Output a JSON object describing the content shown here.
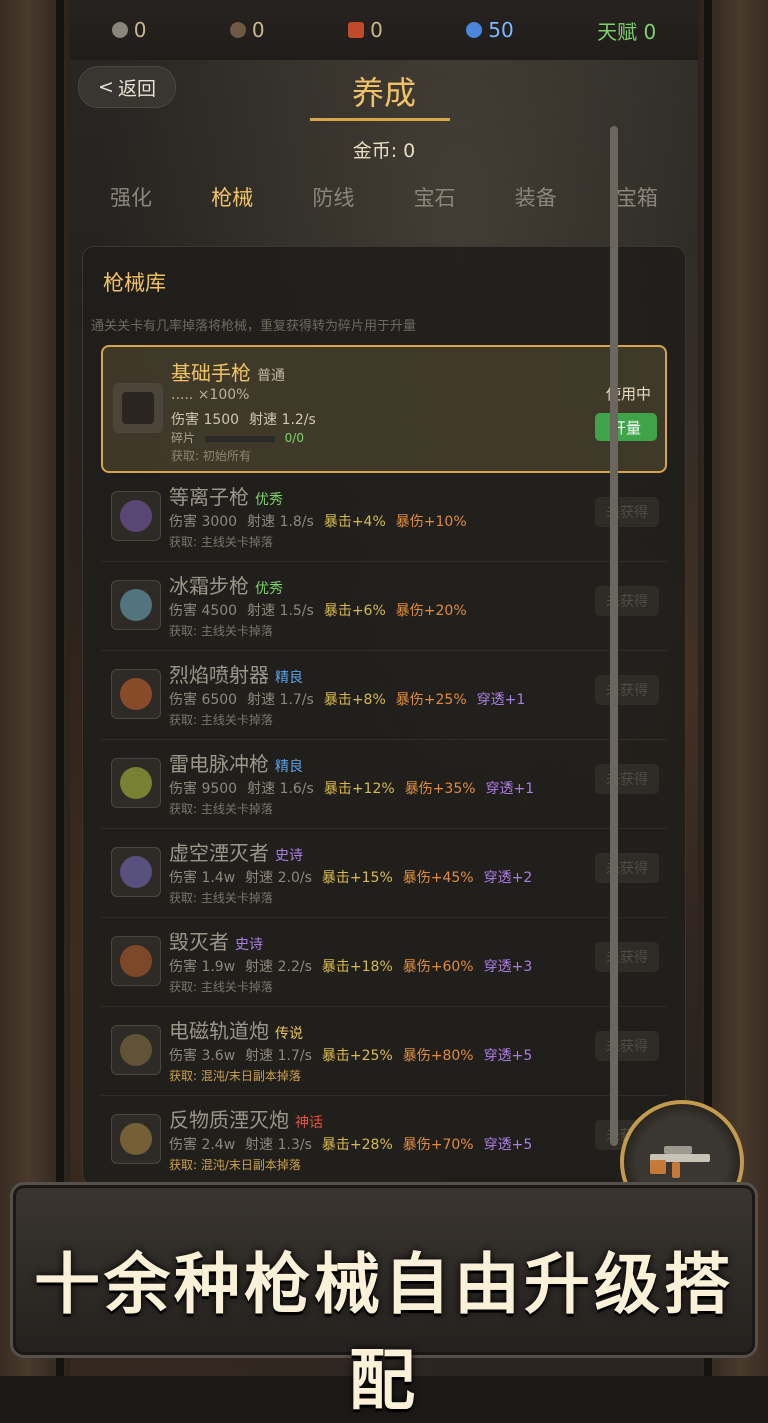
{
  "resources": [
    {
      "icon": "gear-coin-icon",
      "value": "0",
      "color": "#c9b98f"
    },
    {
      "icon": "scrap-icon",
      "value": "0",
      "color": "#c9b98f"
    },
    {
      "icon": "crystal-icon",
      "value": "0",
      "color": "#c9b98f"
    },
    {
      "icon": "gem-icon",
      "value": "50",
      "color": "#7eb6ff"
    }
  ],
  "talent": "天赋 0",
  "back_label": "返回",
  "page_title": "养成",
  "gold": "金币: 0",
  "tabs": [
    "强化",
    "枪械",
    "防线",
    "宝石",
    "装备",
    "宝箱"
  ],
  "active_tab": "枪械",
  "armory": {
    "title": "枪械库",
    "subtitle": "通关关卡有几率掉落将枪械，重复获得转为碎片用于升量",
    "equipped": {
      "name": "基础手枪",
      "rarity": "普通",
      "level": "..... ×100%",
      "dmg": "伤害 1500",
      "rate": "射速 1.2/s",
      "frag_label": "碎片",
      "frag": "0/0",
      "src": "获取: 初始所有",
      "status": "使用中",
      "upgrade": "开量"
    },
    "items": [
      {
        "name": "等离子枪",
        "rarity": "优秀",
        "rcolor": "#7ed36b",
        "dmg": "伤害 3000",
        "rate": "射速 1.8/s",
        "crit": "暴击+4%",
        "cdmg": "暴伤+10%",
        "pierce": "",
        "src": "获取: 主线关卡掉落",
        "btn": "未获得",
        "dot": "#7a5fb0"
      },
      {
        "name": "冰霜步枪",
        "rarity": "优秀",
        "rcolor": "#7ed36b",
        "dmg": "伤害 4500",
        "rate": "射速 1.5/s",
        "crit": "暴击+6%",
        "cdmg": "暴伤+20%",
        "pierce": "",
        "src": "获取: 主线关卡掉落",
        "btn": "未获得",
        "dot": "#6fb0c9"
      },
      {
        "name": "烈焰喷射器",
        "rarity": "精良",
        "rcolor": "#5aa0e8",
        "dmg": "伤害 6500",
        "rate": "射速 1.7/s",
        "crit": "暴击+8%",
        "cdmg": "暴伤+25%",
        "pierce": "穿透+1",
        "src": "获取: 主线关卡掉落",
        "btn": "未获得",
        "dot": "#d1662d"
      },
      {
        "name": "雷电脉冲枪",
        "rarity": "精良",
        "rcolor": "#5aa0e8",
        "dmg": "伤害 9500",
        "rate": "射速 1.6/s",
        "crit": "暴击+12%",
        "cdmg": "暴伤+35%",
        "pierce": "穿透+1",
        "src": "获取: 主线关卡掉落",
        "btn": "未获得",
        "dot": "#b7c63a"
      },
      {
        "name": "虚空湮灭者",
        "rarity": "史诗",
        "rcolor": "#a97ee0",
        "dmg": "伤害 1.4w",
        "rate": "射速 2.0/s",
        "crit": "暴击+15%",
        "cdmg": "暴伤+45%",
        "pierce": "穿透+2",
        "src": "获取: 主线关卡掉落",
        "btn": "未获得",
        "dot": "#7c6fc4"
      },
      {
        "name": "毁灭者",
        "rarity": "史诗",
        "rcolor": "#a97ee0",
        "dmg": "伤害 1.9w",
        "rate": "射速 2.2/s",
        "crit": "暴击+18%",
        "cdmg": "暴伤+60%",
        "pierce": "穿透+3",
        "src": "获取: 主线关卡掉落",
        "btn": "未获得",
        "dot": "#c0612b"
      },
      {
        "name": "电磁轨道炮",
        "rarity": "传说",
        "rcolor": "#e8c25a",
        "dmg": "伤害 3.6w",
        "rate": "射速 1.7/s",
        "crit": "暴击+25%",
        "cdmg": "暴伤+80%",
        "pierce": "穿透+5",
        "src": "获取: 混沌/末日副本掉落",
        "btn": "未获得",
        "dot": "#8a7444"
      },
      {
        "name": "反物质湮灭炮",
        "rarity": "神话",
        "rcolor": "#e8513d",
        "dmg": "伤害 2.4w",
        "rate": "射速 1.3/s",
        "crit": "暴击+28%",
        "cdmg": "暴伤+70%",
        "pierce": "穿透+5",
        "src": "获取: 混沌/末日副本掉落",
        "btn": "未获得",
        "dot": "#b08a45"
      }
    ]
  },
  "banner": "十余种枪械自由升级搭配"
}
